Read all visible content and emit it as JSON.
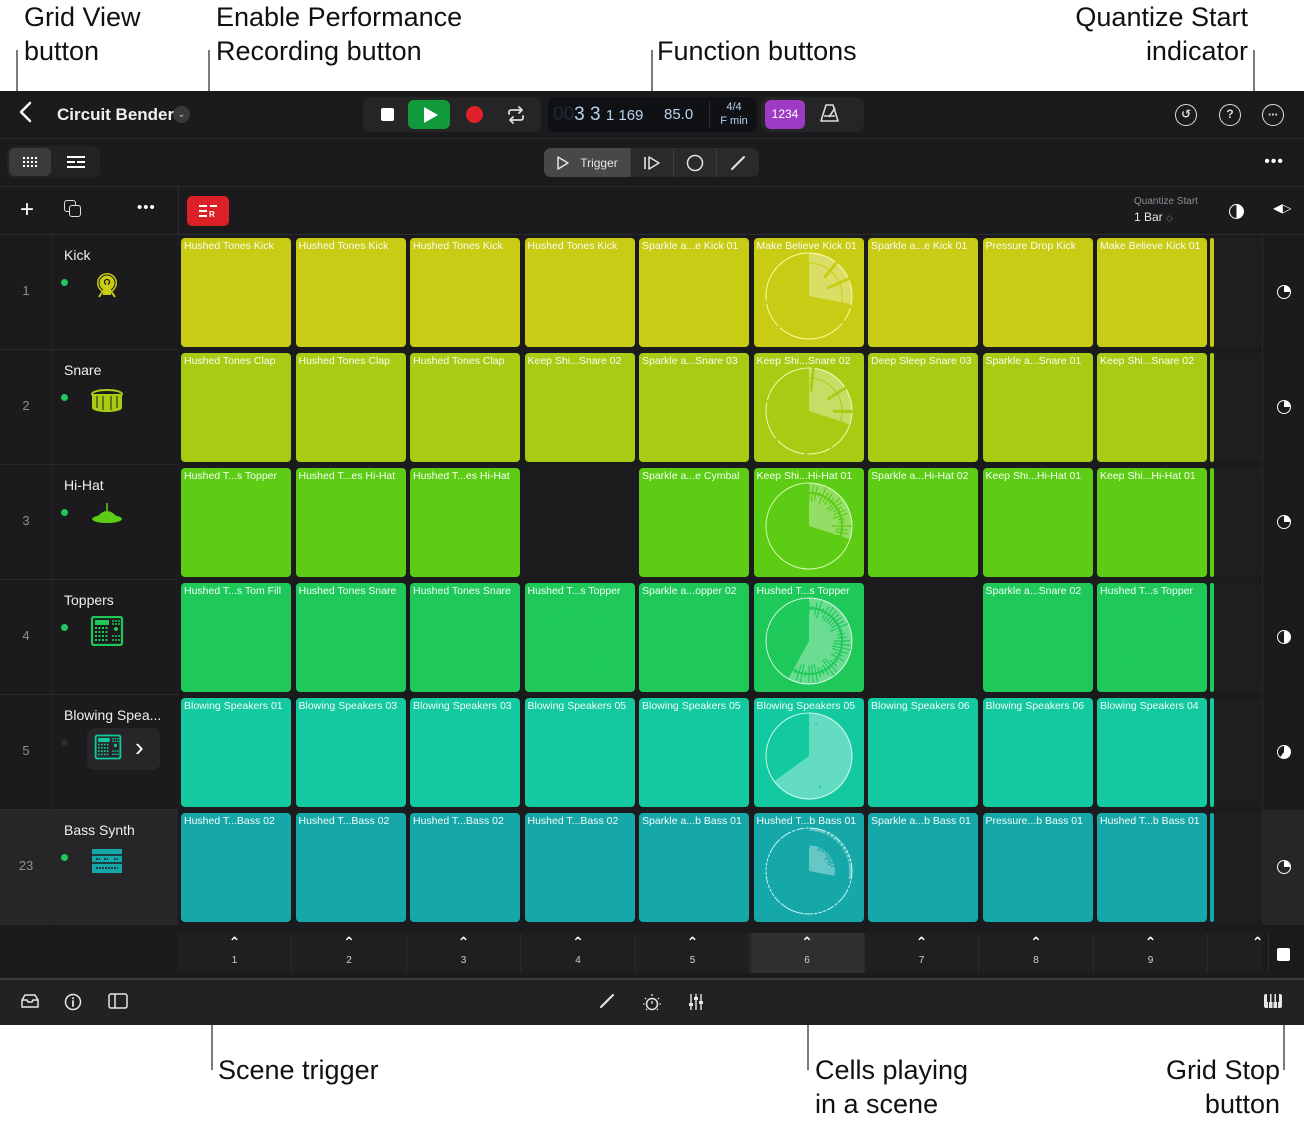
{
  "callouts": {
    "grid_view": [
      "Grid View",
      "button"
    ],
    "perf_rec": [
      "Enable Performance",
      "Recording button"
    ],
    "function_buttons": [
      "Function buttons"
    ],
    "quantize": [
      "Quantize Start",
      "indicator"
    ],
    "scene_trigger": [
      "Scene trigger"
    ],
    "cells_playing": [
      "Cells playing",
      "in a scene"
    ],
    "grid_stop": [
      "Grid Stop",
      "button"
    ]
  },
  "header": {
    "project_title": "Circuit Bender",
    "lcd": {
      "position_dim": "00",
      "position_bar_beat": "3 3",
      "position_div_tick": "1 169",
      "tempo": "85.0",
      "time_signature": "4/4",
      "key": "F min"
    },
    "count_in_label": "1234"
  },
  "function_buttons": {
    "trigger_label": "Trigger"
  },
  "quantize": {
    "label": "Quantize Start",
    "value": "1 Bar"
  },
  "perf_rec_label": "R",
  "tracks": [
    {
      "number": "1",
      "name": "Kick",
      "active": true,
      "color": "#c8cc14",
      "icon": "kick-drum-icon"
    },
    {
      "number": "2",
      "name": "Snare",
      "active": true,
      "color": "#a8cc14",
      "icon": "snare-drum-icon"
    },
    {
      "number": "3",
      "name": "Hi-Hat",
      "active": true,
      "color": "#5ccc14",
      "icon": "hihat-icon"
    },
    {
      "number": "4",
      "name": "Toppers",
      "active": true,
      "color": "#1ec95a",
      "icon": "drum-machine-icon"
    },
    {
      "number": "5",
      "name": "Blowing Spea...",
      "active": false,
      "color": "#12c9a0",
      "icon": "drum-machine-icon"
    },
    {
      "number": "23",
      "name": "Bass Synth",
      "active": true,
      "color": "#16a8a8",
      "icon": "synth-icon"
    }
  ],
  "cells": [
    [
      "Hushed Tones Kick",
      "Hushed Tones Kick",
      "Hushed Tones Kick",
      "Hushed Tones Kick",
      "Sparkle a...e Kick 01",
      "Make Believe Kick 01",
      "Sparkle a...e Kick 01",
      "Pressure Drop Kick",
      "Make Believe Kick 01"
    ],
    [
      "Hushed Tones Clap",
      "Hushed Tones Clap",
      "Hushed Tones Clap",
      "Keep Shi...Snare 02",
      "Sparkle a...Snare 03",
      "Keep Shi...Snare 02",
      "Deep Sleep Snare 03",
      "Sparkle a...Snare 01",
      "Keep Shi...Snare 02"
    ],
    [
      "Hushed T...s Topper",
      "Hushed T...es Hi-Hat",
      "Hushed T...es Hi-Hat",
      "",
      "Sparkle a...e Cymbal",
      "Keep Shi...Hi-Hat 01",
      "Sparkle a...Hi-Hat 02",
      "Keep Shi...Hi-Hat 01",
      "Keep Shi...Hi-Hat 01"
    ],
    [
      "Hushed T...s Tom Fill",
      "Hushed Tones Snare",
      "Hushed Tones Snare",
      "Hushed T...s Topper",
      "Sparkle a...opper 02",
      "Hushed T...s Topper",
      "",
      "Sparkle a...Snare 02",
      "Hushed T...s Topper"
    ],
    [
      "Blowing Speakers 01",
      "Blowing Speakers 03",
      "Blowing Speakers 03",
      "Blowing Speakers 05",
      "Blowing Speakers 05",
      "Blowing Speakers 05",
      "Blowing Speakers 06",
      "Blowing Speakers 06",
      "Blowing Speakers 04"
    ],
    [
      "Hushed T...Bass 02",
      "Hushed T...Bass 02",
      "Hushed T...Bass 02",
      "Hushed T...Bass 02",
      "Sparkle a...b Bass 01",
      "Hushed T...b Bass 01",
      "Sparkle a...b Bass 01",
      "Pressure...b Bass 01",
      "Hushed T...b Bass 01"
    ]
  ],
  "playing_scene_index": 5,
  "playing_progress": [
    0.28,
    0.3,
    0.3,
    0.58,
    0.65,
    0.28
  ],
  "row_stop_progress": [
    0.25,
    0.25,
    0.25,
    0.5,
    0.6,
    0.25
  ],
  "scenes": [
    "1",
    "2",
    "3",
    "4",
    "5",
    "6",
    "7",
    "8",
    "9"
  ]
}
